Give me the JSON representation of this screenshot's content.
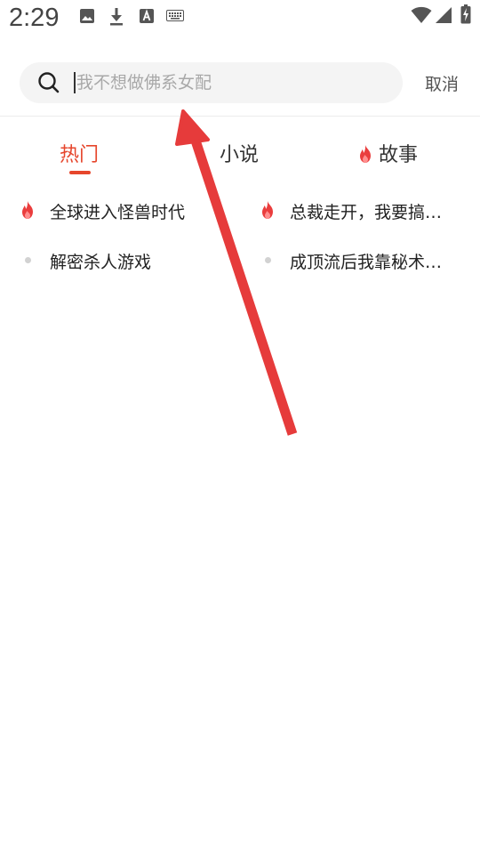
{
  "status_bar": {
    "time": "2:29"
  },
  "search": {
    "placeholder": "我不想做佛系女配",
    "cancel_label": "取消"
  },
  "tabs": [
    {
      "label": "热门",
      "active": true
    },
    {
      "label": "小说",
      "active": false
    },
    {
      "label": "故事",
      "active": false,
      "icon": "fire-icon"
    }
  ],
  "items": [
    {
      "label": "全球进入怪兽时代",
      "icon": "fire-icon"
    },
    {
      "label": "总裁走开，我要搞…",
      "icon": "fire-icon"
    },
    {
      "label": "解密杀人游戏",
      "icon": "dot"
    },
    {
      "label": "成顶流后我靠秘术…",
      "icon": "dot"
    }
  ],
  "colors": {
    "accent": "#e6462c",
    "annotation_arrow": "#e63b3b"
  }
}
